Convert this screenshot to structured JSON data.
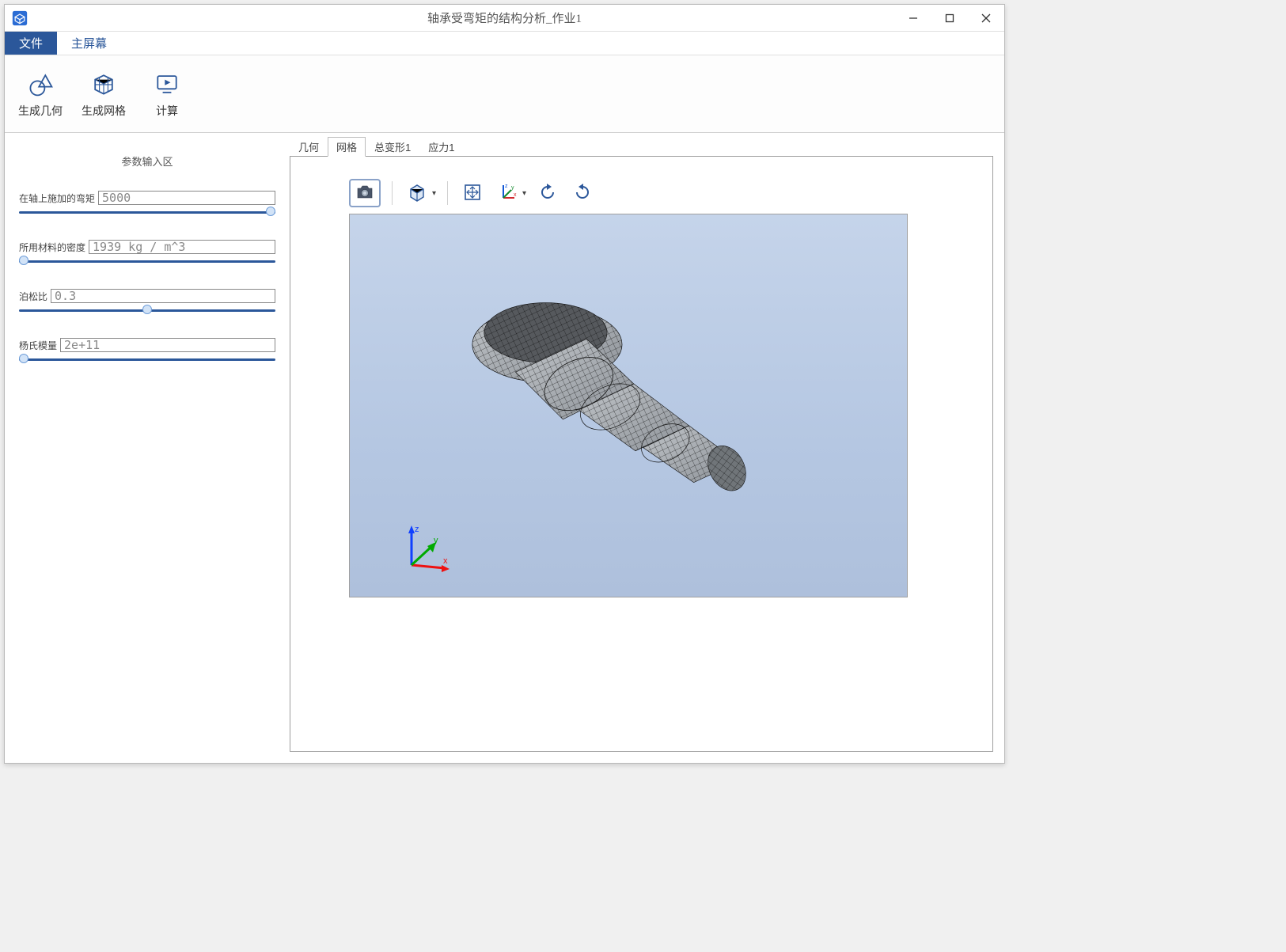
{
  "window": {
    "title": "轴承受弯矩的结构分析_作业1"
  },
  "menu": {
    "file": "文件",
    "main": "主屏幕"
  },
  "ribbon": {
    "gen_geometry": "生成几何",
    "gen_mesh": "生成网格",
    "compute": "计算"
  },
  "sidebar": {
    "title": "参数输入区",
    "params": [
      {
        "label": "在轴上施加的弯矩",
        "value": "5000",
        "thumb_pct": 98
      },
      {
        "label": "所用材料的密度",
        "value": "1939 kg / m^3",
        "thumb_pct": 2
      },
      {
        "label": "泊松比",
        "value": "0.3",
        "thumb_pct": 50
      },
      {
        "label": "杨氏模量",
        "value": "2e+11",
        "thumb_pct": 2
      }
    ]
  },
  "view_tabs": [
    "几何",
    "网格",
    "总变形1",
    "应力1"
  ],
  "active_view_tab": 1,
  "vp_toolbar": {
    "camera": "camera-icon",
    "cube": "view-cube-icon",
    "fit": "fit-view-icon",
    "axes": "axes-icon",
    "rotate_ccw": "rotate-ccw-icon",
    "rotate_cw": "rotate-cw-icon"
  },
  "triad_axes": {
    "x": "x",
    "y": "y",
    "z": "z"
  }
}
